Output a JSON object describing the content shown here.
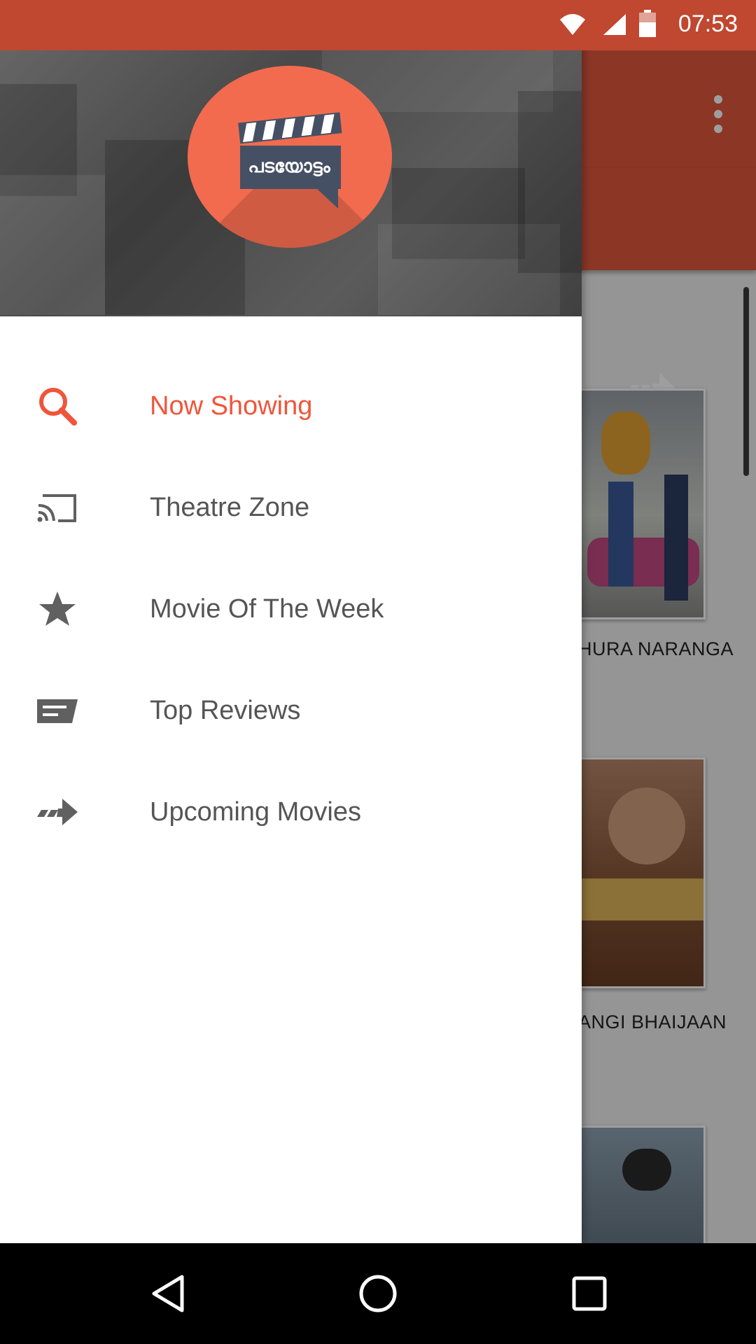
{
  "status_bar": {
    "time": "07:53"
  },
  "drawer": {
    "logo_text": "പടയോട്ടം",
    "items": [
      {
        "label": "Now Showing",
        "icon": "search-icon",
        "active": true
      },
      {
        "label": "Theatre Zone",
        "icon": "cast-icon",
        "active": false
      },
      {
        "label": "Movie Of The Week",
        "icon": "star-icon",
        "active": false
      },
      {
        "label": "Top Reviews",
        "icon": "reviews-icon",
        "active": false
      },
      {
        "label": "Upcoming Movies",
        "icon": "forward-arrow-icon",
        "active": false
      }
    ]
  },
  "background": {
    "movies": [
      {
        "title": "MADHURA NARANGA",
        "visible_caption": "HURA NARANGA"
      },
      {
        "title": "BAJRANGI BHAIJAAN",
        "visible_caption": "ANGI BHAIJAAN"
      },
      {
        "title": "",
        "visible_caption": ""
      }
    ]
  },
  "colors": {
    "accent": "#f0553a",
    "toolbar": "#e2573e",
    "status_bar": "#c04730",
    "logo_circle": "#f26b4f",
    "nav_text": "#555555"
  }
}
